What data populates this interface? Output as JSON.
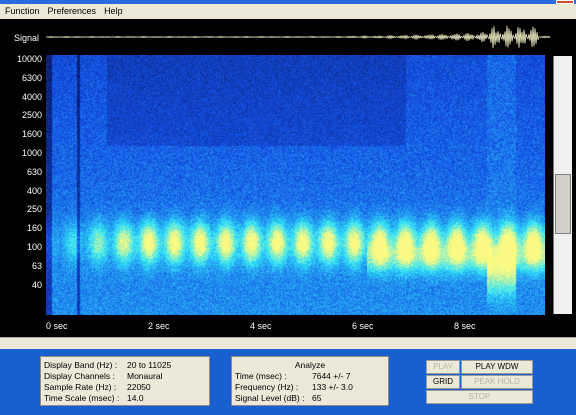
{
  "menu": [
    "Function",
    "Preferences",
    "Help"
  ],
  "signal_label": "Signal",
  "y_ticks": [
    "10000",
    "6300",
    "4000",
    "2500",
    "1600",
    "1000",
    "630",
    "400",
    "250",
    "160",
    "100",
    "63",
    "40"
  ],
  "x_ticks": [
    "0  sec",
    "2  sec",
    "4  sec",
    "6  sec",
    "8  sec"
  ],
  "display": {
    "band_label": "Display Band (Hz) :",
    "band_value": "20 to 11025",
    "channels_label": "Display Channels :",
    "channels_value": "Monaural",
    "rate_label": "Sample Rate (Hz) :",
    "rate_value": "22050",
    "timescale_label": "Time Scale (msec) :",
    "timescale_value": "14.0"
  },
  "analyze": {
    "title": "Analyze",
    "time_label": "Time (msec) :",
    "time_value": "7644 +/- 7",
    "freq_label": "Frequency (Hz) :",
    "freq_value": "133  +/- 3.0",
    "level_label": "Signal Level (dB) :",
    "level_value": "65"
  },
  "buttons": {
    "play": "PLAY",
    "play_wdw": "PLAY WDW",
    "grid": "GRID",
    "peak_hold": "PEAK HOLD",
    "stop": "STOP"
  },
  "colors": {
    "background": "#1a5fd0",
    "plot": "#000000"
  }
}
